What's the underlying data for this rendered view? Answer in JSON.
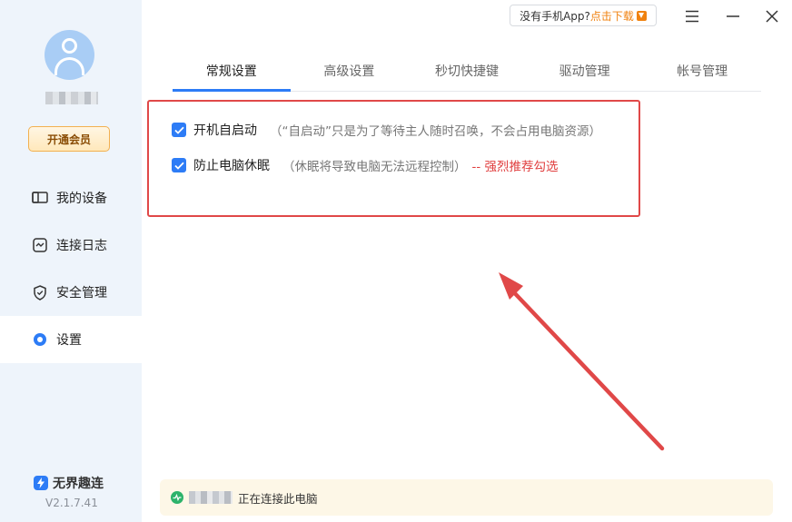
{
  "sidebar": {
    "vip_label": "开通会员",
    "items": [
      {
        "label": "我的设备",
        "icon": "device-icon"
      },
      {
        "label": "连接日志",
        "icon": "log-icon"
      },
      {
        "label": "安全管理",
        "icon": "shield-icon"
      },
      {
        "label": "设置",
        "icon": "settings-dot-icon",
        "active": true
      }
    ],
    "brand_name": "无界趣连",
    "version": "V2.1.7.41"
  },
  "titlebar": {
    "app_prompt": "没有手机App?",
    "app_link": "点击下载"
  },
  "tabs": [
    {
      "label": "常规设置",
      "active": true
    },
    {
      "label": "高级设置"
    },
    {
      "label": "秒切快捷键"
    },
    {
      "label": "驱动管理"
    },
    {
      "label": "帐号管理"
    }
  ],
  "settings": {
    "autostart": {
      "label": "开机自启动",
      "checked": true,
      "desc": "（“自启动”只是为了等待主人随时召唤，不会占用电脑资源）"
    },
    "no_sleep": {
      "label": "防止电脑休眠",
      "checked": true,
      "desc": "（休眠将导致电脑无法远程控制）",
      "warning": "-- 强烈推荐勾选"
    }
  },
  "status": {
    "text": "正在连接此电脑"
  },
  "colors": {
    "accent": "#2d7cf6",
    "annotation": "#e04848",
    "warning": "#e03e3e",
    "vip": "#f3b04f",
    "status_ok": "#2db36b"
  }
}
